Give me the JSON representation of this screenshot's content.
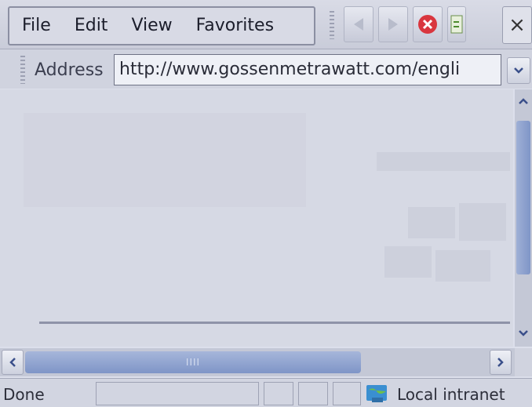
{
  "menu": {
    "file": "File",
    "edit": "Edit",
    "view": "View",
    "favorites": "Favorites"
  },
  "toolbar": {
    "close_label": "×"
  },
  "address": {
    "label": "Address",
    "url": "http://www.gossenmetrawatt.com/engli"
  },
  "status": {
    "text": "Done",
    "zone": "Local intranet"
  },
  "hscroll": {
    "grip": "IIII"
  },
  "colors": {
    "stop_red": "#d9363e",
    "scroll_thumb": "#8a9fd0",
    "intranet_globe": "#3a8fd1"
  }
}
